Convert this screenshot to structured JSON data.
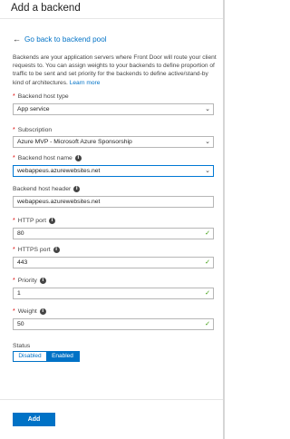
{
  "header": {
    "title": "Add a backend"
  },
  "back_link": {
    "label": "Go back to backend pool"
  },
  "description": {
    "text": "Backends are your application servers where Front Door will route your client requests to. You can assign weights to your backends to define proportion of traffic to be sent and set priority for the backends to define active/stand-by kind of architectures.",
    "learn_more": "Learn more"
  },
  "fields": {
    "host_type": {
      "label": "Backend host type",
      "value": "App service"
    },
    "subscription": {
      "label": "Subscription",
      "value": "Azure MVP - Microsoft Azure Sponsorship"
    },
    "host_name": {
      "label": "Backend host name",
      "value": "webappeus.azurewebsites.net"
    },
    "host_header": {
      "label": "Backend host header",
      "value": "webappeus.azurewebsites.net"
    },
    "http_port": {
      "label": "HTTP port",
      "value": "80"
    },
    "https_port": {
      "label": "HTTPS port",
      "value": "443"
    },
    "priority": {
      "label": "Priority",
      "value": "1"
    },
    "weight": {
      "label": "Weight",
      "value": "50"
    }
  },
  "status": {
    "label": "Status",
    "options": [
      "Disabled",
      "Enabled"
    ],
    "selected": "Enabled"
  },
  "footer": {
    "add_label": "Add"
  },
  "colors": {
    "accent": "#0072c6",
    "required": "#dd0000",
    "valid": "#3a9b0a"
  }
}
